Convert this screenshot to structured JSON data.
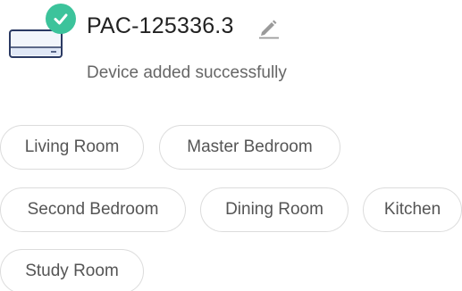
{
  "device": {
    "name": "PAC-125336.3",
    "icon": "air-conditioner-icon",
    "badge_icon": "check-circle-icon",
    "badge_color": "#3cc39b",
    "edit_icon": "pencil-icon"
  },
  "status": {
    "message": "Device added successfully"
  },
  "rooms": [
    {
      "label": "Living Room"
    },
    {
      "label": "Master Bedroom"
    },
    {
      "label": "Second Bedroom"
    },
    {
      "label": "Dining Room"
    },
    {
      "label": "Kitchen"
    },
    {
      "label": "Study Room"
    }
  ]
}
